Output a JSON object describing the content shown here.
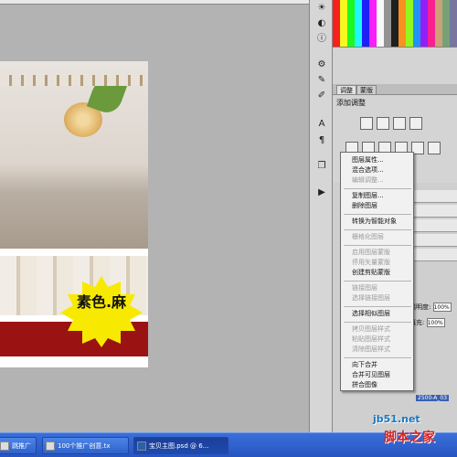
{
  "document": {
    "badge_text": "素色.麻",
    "banner_color": "#9b1212",
    "badge_color": "#f7ea00"
  },
  "toolbar_icons": [
    "compass-icon",
    "color-icon",
    "info-icon",
    "gear-icon",
    "tool-icon",
    "brush-icon",
    "type-icon",
    "paragraph-icon",
    "layers-icon",
    "channels-icon",
    "actions-icon"
  ],
  "adjustments": {
    "tabs": [
      "调整",
      "蒙版"
    ],
    "title": "添加调整"
  },
  "context_menu": {
    "items": [
      {
        "label": "图层属性...",
        "enabled": true
      },
      {
        "label": "混合选项...",
        "enabled": true
      },
      {
        "label": "编辑调整...",
        "enabled": false
      },
      {
        "label": "复制图层...",
        "enabled": true
      },
      {
        "label": "删除图层",
        "enabled": true
      },
      {
        "label": "转换为智能对象",
        "enabled": true
      },
      {
        "label": "栅格化图层",
        "enabled": false
      },
      {
        "label": "启用图层蒙版",
        "enabled": false
      },
      {
        "label": "停用矢量蒙版",
        "enabled": false
      },
      {
        "label": "创建剪贴蒙版",
        "enabled": true
      },
      {
        "label": "链接图层",
        "enabled": false
      },
      {
        "label": "选择链接图层",
        "enabled": false
      },
      {
        "label": "选择相似图层",
        "enabled": true
      },
      {
        "label": "拷贝图层样式",
        "enabled": false
      },
      {
        "label": "粘贴图层样式",
        "enabled": false
      },
      {
        "label": "清除图层样式",
        "enabled": false
      },
      {
        "label": "向下合并",
        "enabled": true
      },
      {
        "label": "合并可见图层",
        "enabled": true
      },
      {
        "label": "拼合图像",
        "enabled": true
      }
    ]
  },
  "layers": {
    "opacity_label": "透明度:",
    "opacity_value": "100%",
    "fill_label": "填充:",
    "fill_value": "100%",
    "layer_name": "2500-A_03"
  },
  "taskbar": {
    "items": [
      "跳推广",
      "100个推广创意.tx",
      "宝贝主图.psd @ 6..."
    ]
  },
  "watermark": {
    "line1": "jb51.net",
    "line2": "脚本之家"
  }
}
